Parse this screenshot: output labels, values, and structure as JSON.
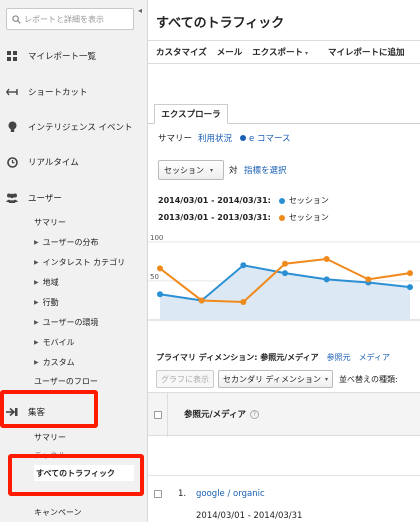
{
  "sidebar": {
    "search_placeholder": "レポートと詳細を表示",
    "nav": [
      {
        "label": "マイレポート一覧",
        "icon": "grid-icon"
      },
      {
        "label": "ショートカット",
        "icon": "shortcut-arrow-icon"
      },
      {
        "label": "インテリジェンス イベント",
        "icon": "lightbulb-icon"
      },
      {
        "label": "リアルタイム",
        "icon": "clock-icon"
      },
      {
        "label": "ユーザー",
        "icon": "users-icon"
      }
    ],
    "audience_sub": {
      "summary": "サマリー",
      "items": [
        "ユーザーの分布",
        "インタレスト カテゴリ",
        "地域",
        "行動",
        "ユーザーの環境",
        "モバイル",
        "カスタム"
      ],
      "flow": "ユーザーのフロー"
    },
    "acquisition": {
      "label": "集客",
      "summary": "サマリー",
      "channels": "チャネル",
      "all_traffic": "すべてのトラフィック",
      "campaigns": "キャンペーン"
    },
    "highlight_color": "#ff1a00"
  },
  "main": {
    "title": "すべてのトラフィック",
    "toolbar": [
      "カスタマイズ",
      "メール",
      "エクスポート",
      "マイレポートに追加"
    ],
    "explorer_tab": "エクスプローラ",
    "subnav": {
      "summary": "サマリー",
      "usage": "利用状況",
      "ecommerce": "e コマース"
    },
    "metric_select": "セッション",
    "vs": "対",
    "choose_metric": "指標を選択",
    "legend": [
      {
        "range": "2014/03/01 - 2014/03/31:",
        "label": "セッション",
        "color": "#2b8fd4"
      },
      {
        "range": "2013/03/01 - 2013/03/31:",
        "label": "セッション",
        "color": "#f08a1c"
      }
    ],
    "primary_dimension": {
      "label": "プライマリ ディメンション: 参照元/メディア",
      "option1": "参照元",
      "option2": "メディア"
    },
    "controls": {
      "graph_button": "グラフに表示",
      "secondary_dimension": "セカンダリ ディメンション",
      "sort_type": "並べ替えの種類:"
    },
    "table": {
      "column_header": "参照元/メディア",
      "rows": [
        {
          "num": "1.",
          "source": "google / organic",
          "date_range": "2014/03/01 - 2014/03/31"
        }
      ]
    }
  },
  "chart_data": {
    "type": "line",
    "x": [
      "1",
      "2",
      "3",
      "4",
      "5",
      "6",
      "7"
    ],
    "ytick_labels": [
      "100",
      "50"
    ],
    "ylim": [
      0,
      110
    ],
    "series": [
      {
        "name": "2014/03/01 - 2014/03/31",
        "color": "#2b8fd4",
        "fill": "#dce9f4",
        "values": [
          33,
          25,
          70,
          60,
          52,
          48,
          42
        ]
      },
      {
        "name": "2013/03/01 - 2013/03/31",
        "color": "#f08a1c",
        "values": [
          66,
          25,
          23,
          72,
          78,
          52,
          60
        ]
      }
    ]
  }
}
